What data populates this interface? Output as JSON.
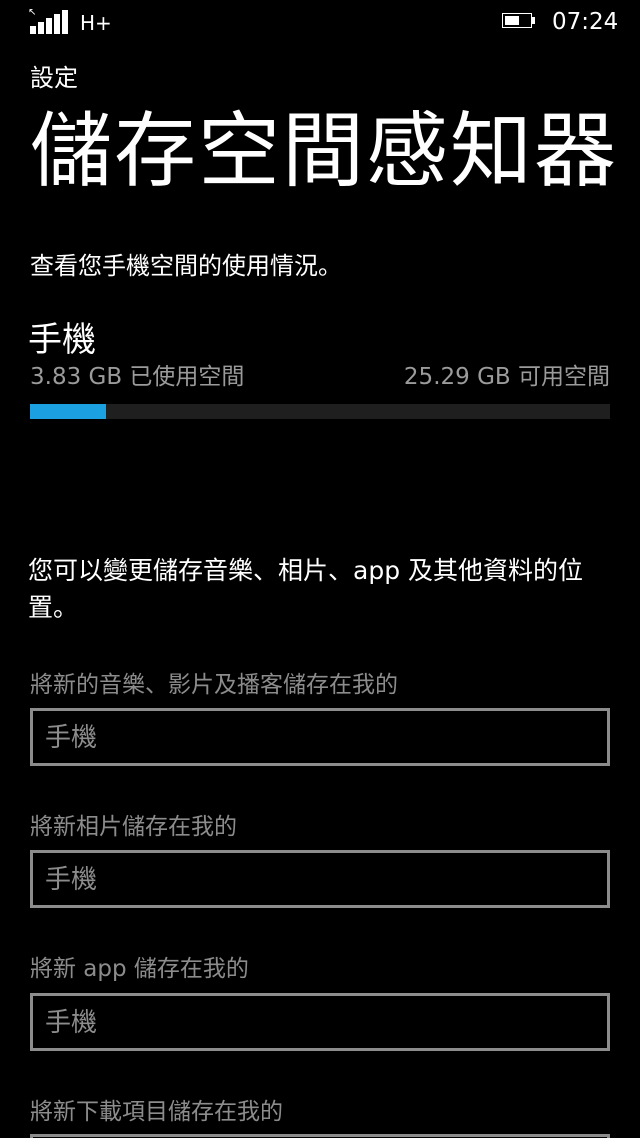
{
  "status_bar": {
    "network_type": "H+",
    "battery_level": 0.6,
    "time": "07:24"
  },
  "header": {
    "app_name": "設定",
    "title": "儲存空間感知器"
  },
  "intro": "查看您手機空間的使用情況。",
  "storage": {
    "device": "手機",
    "used": "3.83 GB 已使用空間",
    "free": "25.29 GB 可用空間",
    "used_fraction": 0.1315,
    "bar_color": "#1ba1e2"
  },
  "description": "您可以變更儲存音樂、相片、app 及其他資料的位置。",
  "settings": [
    {
      "label": "將新的音樂、影片及播客儲存在我的",
      "value": "手機"
    },
    {
      "label": "將新相片儲存在我的",
      "value": "手機"
    },
    {
      "label": "將新 app 儲存在我的",
      "value": "手機"
    },
    {
      "label": "將新下載項目儲存在我的"
    }
  ]
}
